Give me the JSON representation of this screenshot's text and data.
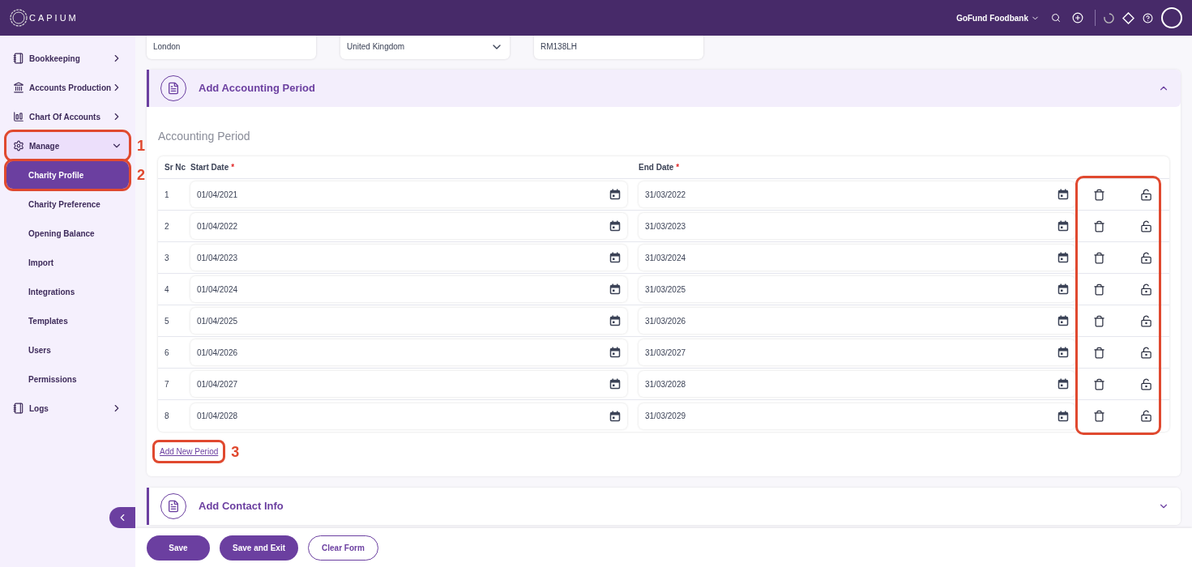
{
  "topbar": {
    "logo": "CAPIUM",
    "org": "GoFund Foodbank"
  },
  "sidebar": {
    "items": [
      {
        "label": "Bookkeeping",
        "expanded": false,
        "selected": false
      },
      {
        "label": "Accounts Production",
        "expanded": false,
        "selected": false
      },
      {
        "label": "Chart Of Accounts",
        "expanded": false,
        "selected": false
      },
      {
        "label": "Manage",
        "expanded": true,
        "selected": true,
        "callout": "1",
        "children": [
          {
            "label": "Charity Profile",
            "selected": true,
            "callout": "2"
          },
          {
            "label": "Charity Preference",
            "selected": false
          },
          {
            "label": "Opening Balance",
            "selected": false
          },
          {
            "label": "Import",
            "selected": false
          },
          {
            "label": "Integrations",
            "selected": false
          },
          {
            "label": "Templates",
            "selected": false
          },
          {
            "label": "Users",
            "selected": false
          },
          {
            "label": "Permissions",
            "selected": false
          }
        ]
      },
      {
        "label": "Logs",
        "expanded": false,
        "selected": false
      }
    ]
  },
  "address_fields": [
    {
      "kind": "text",
      "value": "London"
    },
    {
      "kind": "select",
      "value": "United Kingdom"
    },
    {
      "kind": "text",
      "value": "RM138LH"
    }
  ],
  "accounting_section": {
    "title": "Add Accounting Period",
    "expanded": true,
    "subtitle": "Accounting Period",
    "table": {
      "columns": [
        {
          "label": "Sr Nc"
        },
        {
          "label": "Start Date",
          "required_mark": "*"
        },
        {
          "label": "End Date",
          "required_mark": "*"
        }
      ],
      "actions_highlighted": true,
      "rows": [
        {
          "sr": "1",
          "start": "01/04/2021",
          "end": "31/03/2022"
        },
        {
          "sr": "2",
          "start": "01/04/2022",
          "end": "31/03/2023"
        },
        {
          "sr": "3",
          "start": "01/04/2023",
          "end": "31/03/2024"
        },
        {
          "sr": "4",
          "start": "01/04/2024",
          "end": "31/03/2025"
        },
        {
          "sr": "5",
          "start": "01/04/2025",
          "end": "31/03/2026"
        },
        {
          "sr": "6",
          "start": "01/04/2026",
          "end": "31/03/2027"
        },
        {
          "sr": "7",
          "start": "01/04/2027",
          "end": "31/03/2028"
        },
        {
          "sr": "8",
          "start": "01/04/2028",
          "end": "31/03/2029"
        }
      ]
    },
    "add_link": {
      "label": "Add New Period",
      "callout": "3"
    }
  },
  "contact_section": {
    "title": "Add Contact Info",
    "expanded": false
  },
  "buttons": [
    {
      "kind": "primary",
      "label": "Save"
    },
    {
      "kind": "primary",
      "label": "Save and Exit"
    },
    {
      "kind": "outline",
      "label": "Clear Form"
    }
  ]
}
